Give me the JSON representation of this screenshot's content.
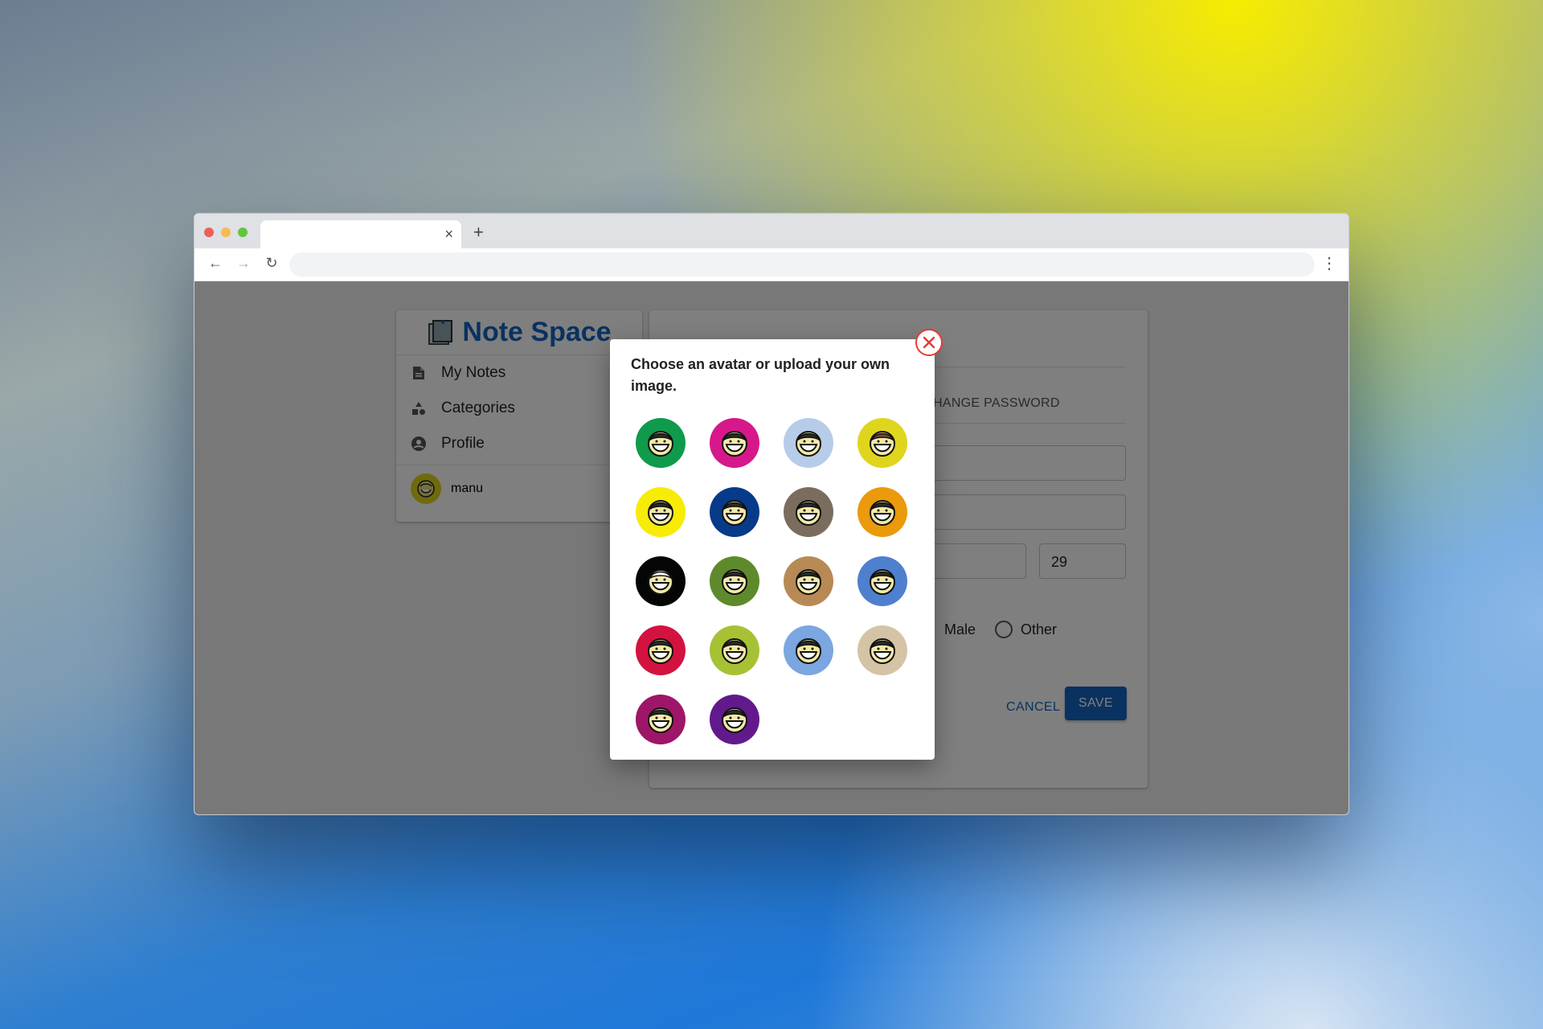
{
  "browser": {
    "tab_close": "×",
    "new_tab": "+",
    "back": "←",
    "forward": "→",
    "reload": "↻",
    "menu": "⋮"
  },
  "sidebar": {
    "brand": "Note Space",
    "items": [
      {
        "label": "My Notes",
        "icon": "document-icon"
      },
      {
        "label": "Categories",
        "icon": "shapes-icon"
      },
      {
        "label": "Profile",
        "icon": "account-circle-icon"
      }
    ],
    "user": {
      "name": "manu",
      "avatar_color": "#e0d51d"
    }
  },
  "profile": {
    "tab_change_password": "HANGE PASSWORD",
    "age_value": "29",
    "gender_options": [
      "Male",
      "Other"
    ],
    "cancel_label": "CANCEL",
    "save_label": "SAVE",
    "accent": "#1565c0"
  },
  "dialog": {
    "title": "Choose an avatar or upload your own image.",
    "close_color": "#e53935",
    "avatars": [
      {
        "color": "#0f9a4c",
        "face": "#2b2b2b"
      },
      {
        "color": "#d6188a",
        "face": "#2b2b2b"
      },
      {
        "color": "#b7cce8",
        "face": "#2b2b2b"
      },
      {
        "color": "#e0d51d",
        "face": "#7a4b2a"
      },
      {
        "color": "#f7ec05",
        "face": "#2b2b2b"
      },
      {
        "color": "#083a8a",
        "face": "#2b2b2b"
      },
      {
        "color": "#7b6d5e",
        "face": "#2b2b2b"
      },
      {
        "color": "#ea9a0b",
        "face": "#2b2b2b"
      },
      {
        "color": "#050505",
        "face": "#ffffff"
      },
      {
        "color": "#5f8a2b",
        "face": "#2b2b2b"
      },
      {
        "color": "#b78a55",
        "face": "#2b2b2b"
      },
      {
        "color": "#4f7fcf",
        "face": "#2b2b2b"
      },
      {
        "color": "#d3123f",
        "face": "#2b2b2b"
      },
      {
        "color": "#a6c234",
        "face": "#2b2b2b"
      },
      {
        "color": "#7ba6df",
        "face": "#2b2b2b"
      },
      {
        "color": "#d4c4a5",
        "face": "#2b2b2b"
      },
      {
        "color": "#9e1667",
        "face": "#2b2b2b"
      },
      {
        "color": "#62198c",
        "face": "#2b2b2b"
      }
    ]
  }
}
